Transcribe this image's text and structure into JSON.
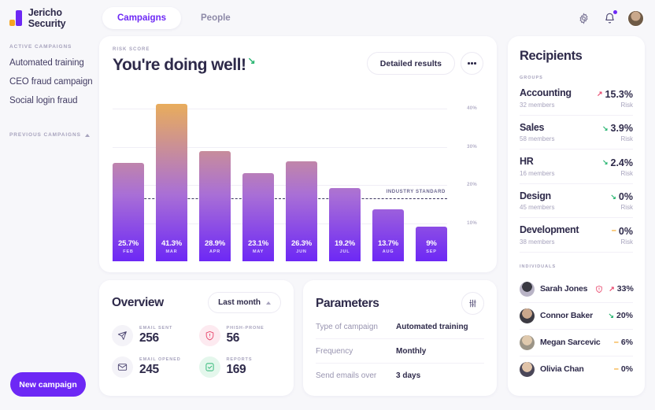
{
  "header": {
    "brand": "Jericho Security",
    "tabs": [
      {
        "label": "Campaigns",
        "active": true
      },
      {
        "label": "People",
        "active": false
      }
    ],
    "icons": {
      "settings": "gear-icon",
      "notifications": "bell-icon",
      "avatar": "user-avatar"
    }
  },
  "sidebar": {
    "active_label": "ACTIVE CAMPAIGNS",
    "items": [
      {
        "label": "Automated training"
      },
      {
        "label": "CEO fraud campaign"
      },
      {
        "label": "Social login fraud"
      }
    ],
    "previous_label": "PREVIOUS CAMPAIGNS",
    "new_campaign": "New campaign"
  },
  "chart_card": {
    "kicker": "RISK SCORE",
    "title": "You're doing well!",
    "trend_arrow": "↘",
    "detailed_results": "Detailed results",
    "more": "more-options"
  },
  "chart_data": {
    "type": "bar",
    "title": "Risk score",
    "categories": [
      "FEB",
      "MAR",
      "APR",
      "MAY",
      "JUN",
      "JUL",
      "AUG",
      "SEP"
    ],
    "values": [
      25.7,
      41.3,
      28.9,
      23.1,
      26.3,
      19.2,
      13.7,
      9
    ],
    "labels": [
      "25.7%",
      "41.3%",
      "28.9%",
      "23.1%",
      "26.3%",
      "19.2%",
      "13.7%",
      "9%"
    ],
    "ylim": [
      0,
      46
    ],
    "yticks": [
      40,
      30,
      20,
      10
    ],
    "ytick_labels": [
      "40%",
      "30%",
      "20%",
      "10%"
    ],
    "xlabel": "",
    "ylabel": "",
    "grid": true,
    "legend": "none",
    "annotations": [
      {
        "label": "INDUSTRY STANDARD",
        "type": "threshold-line",
        "value": 16.5
      }
    ]
  },
  "overview": {
    "title": "Overview",
    "range": "Last month",
    "stats": [
      {
        "label": "EMAIL SENT",
        "value": "256",
        "icon": "send-icon",
        "tone": "grey"
      },
      {
        "label": "PHISH-PRONE",
        "value": "56",
        "icon": "shield-alert-icon",
        "tone": "pink"
      },
      {
        "label": "EMAIL OPENED",
        "value": "245",
        "icon": "envelope-icon",
        "tone": "grey"
      },
      {
        "label": "REPORTS",
        "value": "169",
        "icon": "check-square-icon",
        "tone": "green"
      }
    ]
  },
  "parameters": {
    "title": "Parameters",
    "settings_icon": "sliders-icon",
    "rows": [
      {
        "key": "Type of campaign",
        "value": "Automated training"
      },
      {
        "key": "Frequency",
        "value": "Monthly"
      },
      {
        "key": "Send emails over",
        "value": "3 days"
      }
    ]
  },
  "recipients": {
    "title": "Recipients",
    "groups_label": "GROUPS",
    "risk_label": "Risk",
    "groups": [
      {
        "name": "Accounting",
        "members": "32 members",
        "value": "15.3%",
        "trend": "up",
        "arrow": "↗"
      },
      {
        "name": "Sales",
        "members": "58 members",
        "value": "3.9%",
        "trend": "down",
        "arrow": "↘"
      },
      {
        "name": "HR",
        "members": "16 members",
        "value": "2.4%",
        "trend": "down",
        "arrow": "↘"
      },
      {
        "name": "Design",
        "members": "45 members",
        "value": "0%",
        "trend": "down",
        "arrow": "↘"
      },
      {
        "name": "Development",
        "members": "38 members",
        "value": "0%",
        "trend": "flat",
        "arrow": "–"
      }
    ],
    "individuals_label": "INDIVIDUALS",
    "individuals": [
      {
        "name": "Sarah Jones",
        "value": "33%",
        "trend": "up",
        "arrow": "↗",
        "warning": true
      },
      {
        "name": "Connor Baker",
        "value": "20%",
        "trend": "down",
        "arrow": "↘",
        "warning": false
      },
      {
        "name": "Megan Sarcevic",
        "value": "6%",
        "trend": "flat",
        "arrow": "–",
        "warning": false
      },
      {
        "name": "Olivia Chan",
        "value": "0%",
        "trend": "flat",
        "arrow": "–",
        "warning": false
      }
    ]
  },
  "colors": {
    "accent": "#6d28f5",
    "bar_top": "#f5b944",
    "bar_bottom": "#6d28f5",
    "risk_up": "#e8456b",
    "risk_down": "#2bb673",
    "risk_flat": "#f5a524",
    "page_bg": "#f7f7fa"
  }
}
